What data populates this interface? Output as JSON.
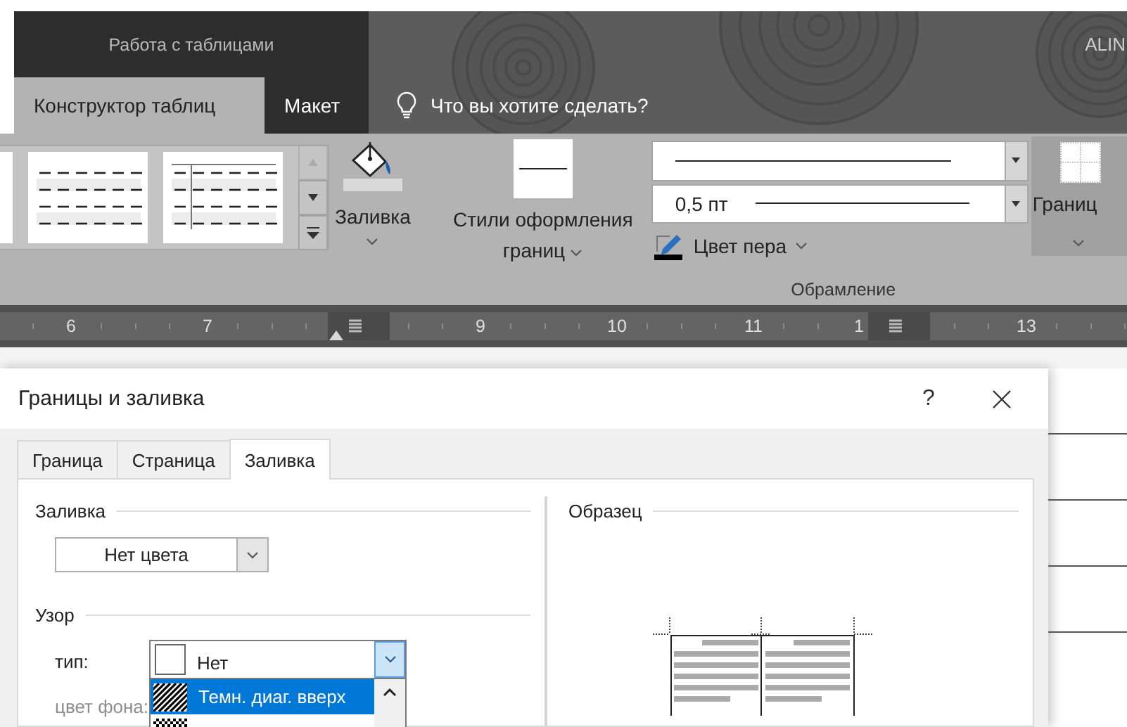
{
  "context_tab_group": {
    "title": "Работа с таблицами"
  },
  "account": {
    "name": "ALIN"
  },
  "tabs": [
    {
      "label": "Конструктор таблиц",
      "selected": true
    },
    {
      "label": "Макет",
      "selected": false
    }
  ],
  "tell_me": {
    "placeholder": "Что вы хотите сделать?"
  },
  "ribbon": {
    "style_gallery": [
      {
        "kind": "partial"
      },
      {
        "kind": "banded"
      },
      {
        "kind": "first_column"
      }
    ],
    "gallery_scroll": [
      {
        "kind": "up",
        "disabled": true
      },
      {
        "kind": "down",
        "disabled": false
      },
      {
        "kind": "more",
        "disabled": false
      }
    ],
    "fill_button": {
      "label": "Заливка"
    },
    "border_styles_button": {
      "label": "Стили оформления границ"
    },
    "line_style_combo": {
      "kind": "solid"
    },
    "line_weight_combo": {
      "value": "0,5 пт"
    },
    "pen_color_button": {
      "label": "Цвет пера"
    },
    "borders_button": {
      "label": "Границ"
    },
    "group_label": "Обрамление"
  },
  "ruler": [
    {
      "kind": "number",
      "text": "6"
    },
    {
      "kind": "number",
      "text": "7"
    },
    {
      "kind": "marker"
    },
    {
      "kind": "number",
      "text": "9"
    },
    {
      "kind": "number",
      "text": "10"
    },
    {
      "kind": "number",
      "text": "11"
    },
    {
      "kind": "number_marker",
      "text": "1"
    },
    {
      "kind": "number",
      "text": "13"
    }
  ],
  "dialog": {
    "title": "Границы и заливка",
    "help": "?",
    "tabs": [
      {
        "label": "Граница",
        "selected": false
      },
      {
        "label": "Страница",
        "selected": false
      },
      {
        "label": "Заливка",
        "selected": true
      }
    ],
    "fill_section": {
      "legend": "Заливка",
      "color_value": "Нет цвета"
    },
    "pattern_section": {
      "legend": "Узор",
      "type_label": "тип:",
      "type_value": "Нет",
      "type_list": [
        {
          "kind": "dark_up_diagonal",
          "label": "Темн. диаг. вверх",
          "selected": true
        },
        {
          "kind": "checker",
          "selected": false
        }
      ],
      "background_label": "цвет фона:",
      "background_disabled": true
    },
    "preview": {
      "legend": "Образец"
    }
  }
}
